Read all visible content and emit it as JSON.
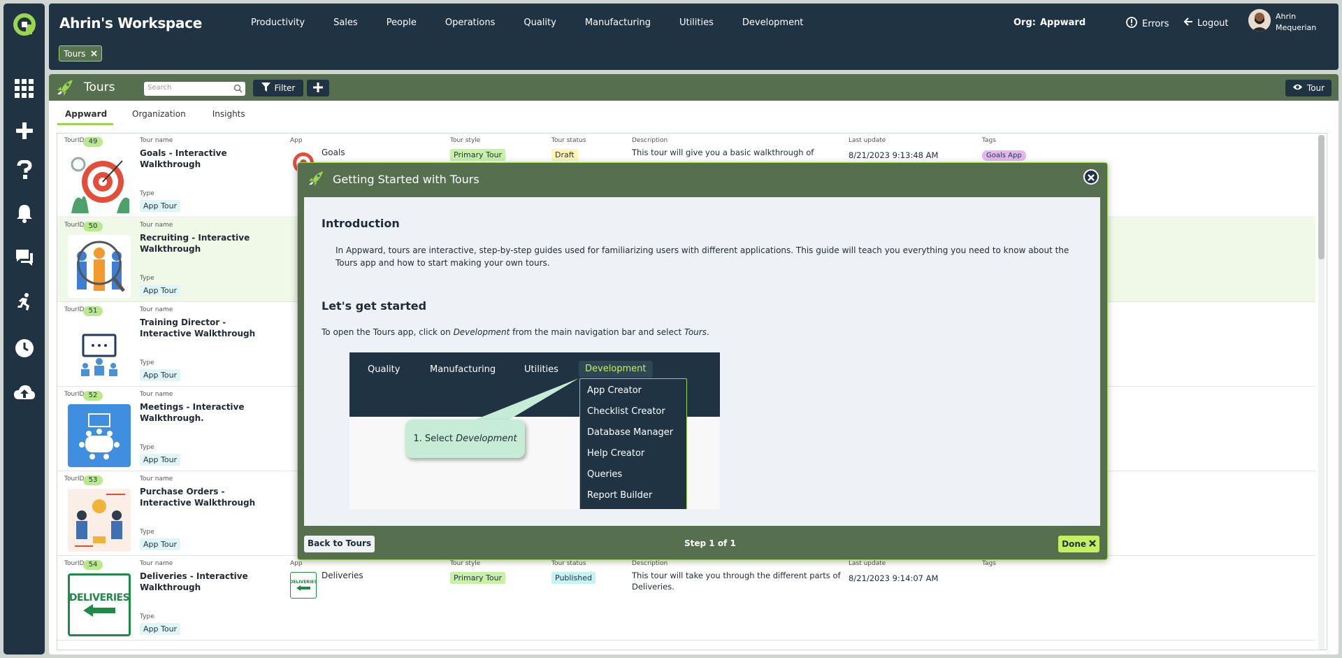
{
  "header": {
    "workspace_title": "Ahrin's Workspace",
    "nav": [
      "Productivity",
      "Sales",
      "People",
      "Operations",
      "Quality",
      "Manufacturing",
      "Utilities",
      "Development"
    ],
    "org_label": "Org:",
    "org_value": "Appward",
    "errors_label": "Errors",
    "logout_label": "Logout",
    "user_first": "Ahrin",
    "user_last": "Mequerian",
    "open_chip": "Tours"
  },
  "app": {
    "title": "Tours",
    "search_placeholder": "Search",
    "filter_label": "Filter",
    "tour_button": "Tour",
    "tabs": [
      "Appward",
      "Organization",
      "Insights"
    ]
  },
  "columns": {
    "tour_id": "TourID",
    "tour_name": "Tour name",
    "type": "Type",
    "app": "App",
    "tour_style": "Tour style",
    "tour_status": "Tour status",
    "description": "Description",
    "last_update": "Last update",
    "tags": "Tags"
  },
  "rows": [
    {
      "id": "49",
      "name": "Goals - Interactive Walkthrough",
      "type": "App Tour",
      "app": "Goals",
      "style": "Primary Tour",
      "status": "Draft",
      "description": "This tour will give you a basic walkthrough of",
      "updated": "8/21/2023 9:13:48 AM",
      "tag": "Goals App"
    },
    {
      "id": "50",
      "name": "Recruiting - Interactive Walkthrough",
      "type": "App Tour"
    },
    {
      "id": "51",
      "name": "Training Director - Interactive Walkthrough",
      "type": "App Tour"
    },
    {
      "id": "52",
      "name": "Meetings - Interactive Walkthrough.",
      "type": "App Tour"
    },
    {
      "id": "53",
      "name": "Purchase Orders - Interactive Walkthrough",
      "type": "App Tour"
    },
    {
      "id": "54",
      "name": "Deliveries - Interactive Walkthrough",
      "type": "App Tour",
      "app": "Deliveries",
      "style": "Primary Tour",
      "status": "Published",
      "description": "This tour will take you through the different parts of Deliveries.",
      "updated": "8/21/2023 9:14:07 AM",
      "thumb_text": "DELIVERIES",
      "app_icon_text": "DELIVERIES"
    }
  ],
  "modal": {
    "title": "Getting Started with Tours",
    "intro_heading": "Introduction",
    "intro_text": "In Appward, tours are interactive, step-by-step guides used for familiarizing users with different applications. This guide will teach you everything you need to know about the Tours app and how to start making your own tours.",
    "start_heading": "Let's get started",
    "start_text_a": "To open the Tours app, click on ",
    "start_text_em1": "Development",
    "start_text_b": " from the main navigation bar and select ",
    "start_text_em2": "Tours",
    "start_text_c": ".",
    "demo_nav": [
      "Quality",
      "Manufacturing",
      "Utilities",
      "Development"
    ],
    "demo_menu": [
      "App Creator",
      "Checklist Creator",
      "Database Manager",
      "Help Creator",
      "Queries",
      "Report Builder"
    ],
    "callout_prefix": "1. Select ",
    "callout_em": "Development",
    "back_label": "Back to Tours",
    "step_label": "Step 1 of 1",
    "done_label": "Done"
  },
  "colors": {
    "navy": "#1f3343",
    "green_header": "#56704f",
    "accent": "#9bd44e"
  }
}
